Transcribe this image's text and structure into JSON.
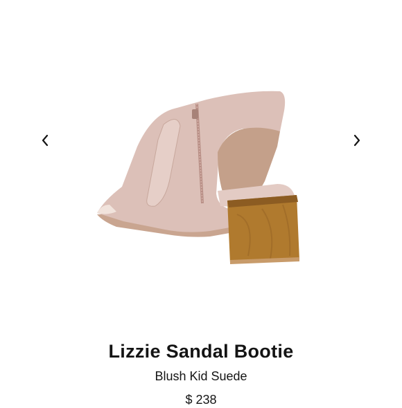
{
  "carousel": {
    "prev_icon": "chevron-left-icon",
    "next_icon": "chevron-right-icon"
  },
  "product": {
    "image_alt": "Lizzie Sandal Bootie",
    "title": "Lizzie Sandal Bootie",
    "subtitle": "Blush Kid Suede",
    "price": "$ 238"
  },
  "colors": {
    "suede": "#dcc0b8",
    "heel": "#b07a2e",
    "text": "#141414"
  }
}
